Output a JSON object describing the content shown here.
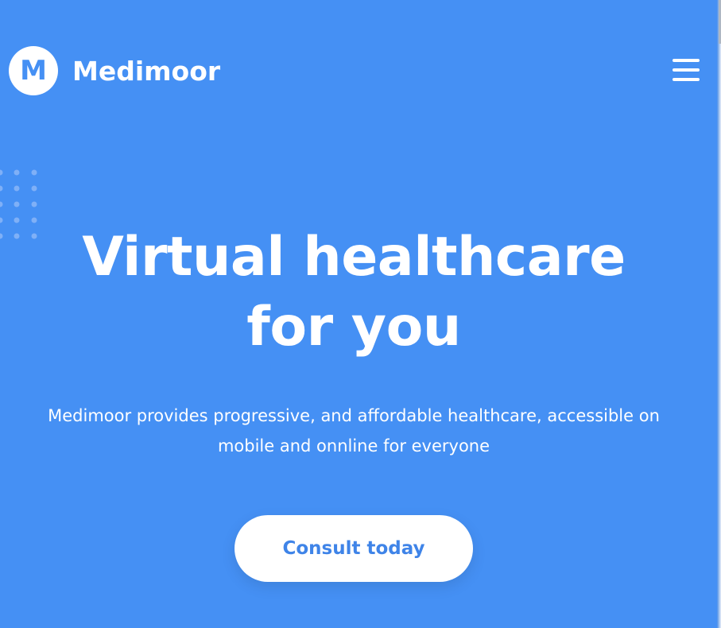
{
  "brand": {
    "logo_letter": "M",
    "name": "Medimoor"
  },
  "header": {
    "menu_icon": "hamburger-menu-icon"
  },
  "decoration": {
    "icon": "dot-grid-pattern"
  },
  "hero": {
    "title_line_1": "Virtual healthcare",
    "title_line_2": "for you",
    "description_line_1": "Medimoor provides progressive, and affordable healthcare, accessible on",
    "description_line_2": "mobile and onnline for everyone",
    "cta_label": "Consult today"
  },
  "colors": {
    "background": "#4590f4",
    "text": "#ffffff",
    "button_background": "#ffffff",
    "button_text": "#3f84e8"
  }
}
